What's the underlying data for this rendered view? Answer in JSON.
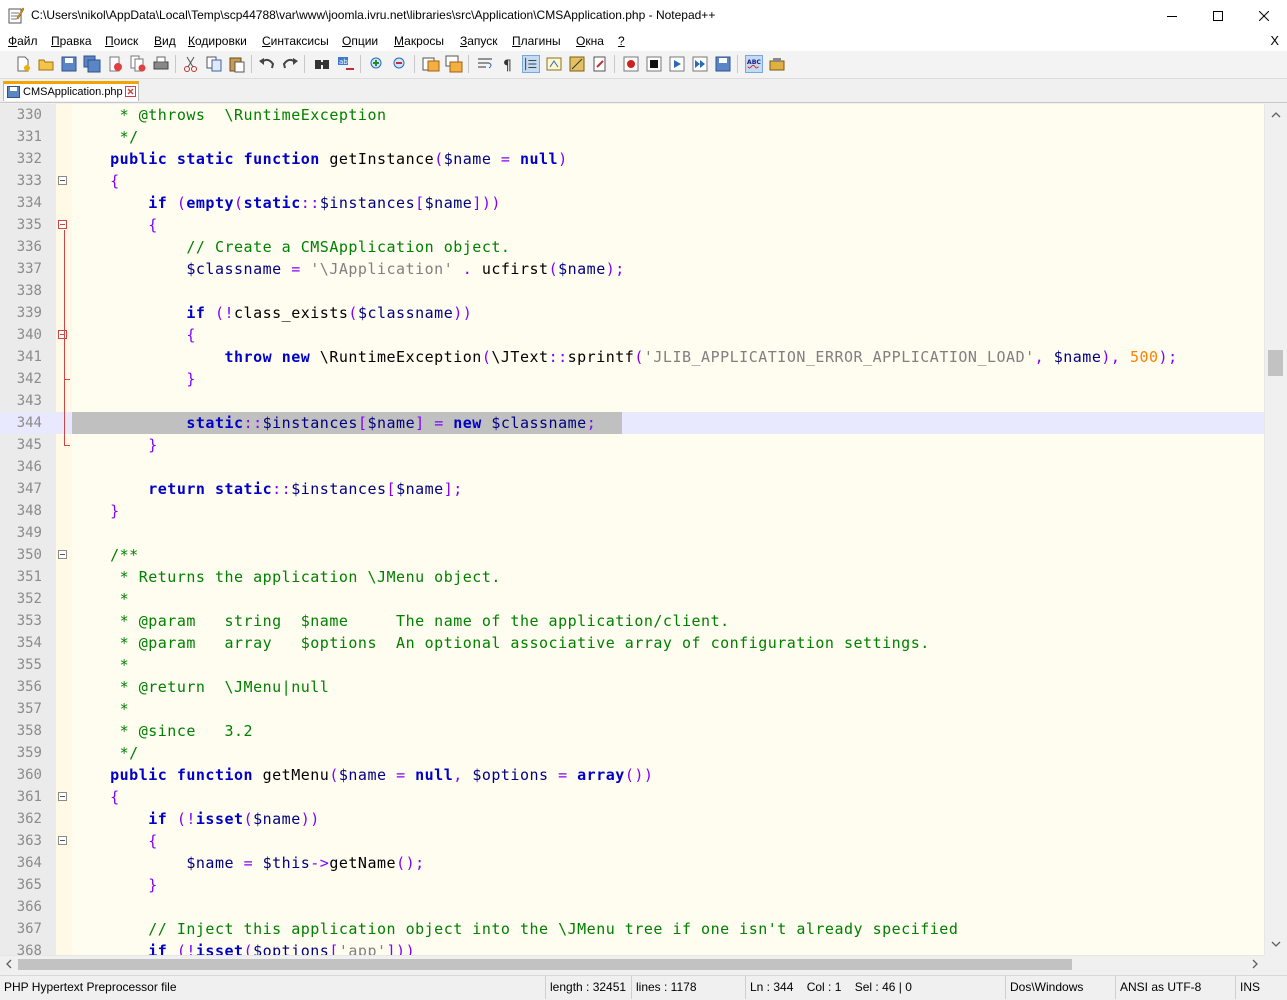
{
  "window": {
    "title": "C:\\Users\\nikol\\AppData\\Local\\Temp\\scp44788\\var\\www\\joomla.ivru.net\\libraries\\src\\Application\\CMSApplication.php - Notepad++"
  },
  "menu": {
    "items": [
      {
        "label": "Файл",
        "underline": "Ф",
        "rest": "айл"
      },
      {
        "label": "Правка",
        "underline": "П",
        "rest": "равка"
      },
      {
        "label": "Поиск",
        "underline": "П",
        "rest": "оиск"
      },
      {
        "label": "Вид",
        "underline": "В",
        "rest": "ид"
      },
      {
        "label": "Кодировки",
        "underline": "К",
        "rest": "одировки"
      },
      {
        "label": "Синтаксисы",
        "underline": "С",
        "rest": "интаксисы"
      },
      {
        "label": "Опции",
        "underline": "О",
        "rest": "пции"
      },
      {
        "label": "Макросы",
        "underline": "М",
        "rest": "акросы"
      },
      {
        "label": "Запуск",
        "underline": "З",
        "rest": "апуск"
      },
      {
        "label": "Плагины",
        "underline": "П",
        "rest": "лагины"
      },
      {
        "label": "Окна",
        "underline": "О",
        "rest": "кна"
      },
      {
        "label": "?",
        "underline": "?",
        "rest": ""
      }
    ],
    "close_label": "X"
  },
  "toolbar": {
    "icons": [
      "new-file-icon",
      "open-file-icon",
      "save-icon",
      "save-all-icon",
      "close-icon",
      "close-all-icon",
      "print-icon",
      "cut-icon",
      "copy-icon",
      "paste-icon",
      "undo-icon",
      "redo-icon",
      "find-icon",
      "replace-icon",
      "zoom-in-icon",
      "zoom-out-icon",
      "sync-vertical-icon",
      "sync-horizontal-icon",
      "word-wrap-icon",
      "show-all-chars-icon",
      "indent-guide-icon",
      "function-list-icon",
      "folder-workspace-icon",
      "document-map-icon",
      "record-macro-icon",
      "stop-record-icon",
      "play-macro-icon",
      "run-macro-multiple-icon",
      "save-macro-icon",
      "spell-check-icon",
      "plugin-icon"
    ]
  },
  "tab": {
    "label": "CMSApplication.php"
  },
  "editor": {
    "lines": [
      {
        "n": "330",
        "html": "     <span class=\"cm\">* @throws  \\RuntimeException</span>"
      },
      {
        "n": "331",
        "html": "     <span class=\"cm\">*/</span>"
      },
      {
        "n": "332",
        "html": "    <span class=\"kw\">public</span> <span class=\"kw\">static</span> <span class=\"kw\">function</span> getInstance<span class=\"br\">(</span><span class=\"var\">$name</span> <span class=\"op\">=</span> <span class=\"kw\">null</span><span class=\"br\">)</span>"
      },
      {
        "n": "333",
        "html": "    <span class=\"br\">{</span>",
        "fold": "open"
      },
      {
        "n": "334",
        "html": "        <span class=\"kw\">if</span> <span class=\"br\">(</span><span class=\"kw\">empty</span><span class=\"br\">(</span><span class=\"kw\">static</span><span class=\"op\">::</span><span class=\"var\">$instances</span><span class=\"br\">[</span><span class=\"var\">$name</span><span class=\"br\">]))</span>"
      },
      {
        "n": "335",
        "html": "        <span class=\"br\">{</span>",
        "fold": "red"
      },
      {
        "n": "336",
        "html": "            <span class=\"cm\">// Create a CMSApplication object.</span>"
      },
      {
        "n": "337",
        "html": "            <span class=\"var\">$classname</span> <span class=\"op\">=</span> <span class=\"str\">'\\JApplication'</span> <span class=\"op\">.</span> ucfirst<span class=\"br\">(</span><span class=\"var\">$name</span><span class=\"br\">)</span><span class=\"op\">;</span>"
      },
      {
        "n": "338",
        "html": ""
      },
      {
        "n": "339",
        "html": "            <span class=\"kw\">if</span> <span class=\"br\">(</span><span class=\"op\">!</span>class_exists<span class=\"br\">(</span><span class=\"var\">$classname</span><span class=\"br\">))</span>"
      },
      {
        "n": "340",
        "html": "            <span class=\"br\">{</span>",
        "fold": "red"
      },
      {
        "n": "341",
        "html": "                <span class=\"kw\">throw</span> <span class=\"kw\">new</span> \\RuntimeException<span class=\"br\">(</span>\\JText<span class=\"op\">::</span>sprintf<span class=\"br\">(</span><span class=\"str\">'JLIB_APPLICATION_ERROR_APPLICATION_LOAD'</span><span class=\"op\">,</span> <span class=\"var\">$name</span><span class=\"br\">)</span><span class=\"op\">,</span> <span class=\"num\">500</span><span class=\"br\">)</span><span class=\"op\">;</span>"
      },
      {
        "n": "342",
        "html": "            <span class=\"br\">}</span>"
      },
      {
        "n": "343",
        "html": ""
      },
      {
        "n": "344",
        "html": "            <span class=\"kw\">static</span><span class=\"op\">::</span><span class=\"var\">$instances</span><span class=\"br\">[</span><span class=\"var\">$name</span><span class=\"br\">]</span> <span class=\"op\">=</span> <span class=\"kw\">new</span> <span class=\"var\">$classname</span><span class=\"op\">;</span>",
        "current": true
      },
      {
        "n": "345",
        "html": "        <span class=\"br\">}</span>"
      },
      {
        "n": "346",
        "html": ""
      },
      {
        "n": "347",
        "html": "        <span class=\"kw\">return</span> <span class=\"kw\">static</span><span class=\"op\">::</span><span class=\"var\">$instances</span><span class=\"br\">[</span><span class=\"var\">$name</span><span class=\"br\">]</span><span class=\"op\">;</span>"
      },
      {
        "n": "348",
        "html": "    <span class=\"br\">}</span>"
      },
      {
        "n": "349",
        "html": ""
      },
      {
        "n": "350",
        "html": "    <span class=\"cm\">/**</span>",
        "fold": "open"
      },
      {
        "n": "351",
        "html": "     <span class=\"cm\">* Returns the application \\JMenu object.</span>"
      },
      {
        "n": "352",
        "html": "     <span class=\"cm\">*</span>"
      },
      {
        "n": "353",
        "html": "     <span class=\"cm\">* @param   string  $name     The name of the application/client.</span>"
      },
      {
        "n": "354",
        "html": "     <span class=\"cm\">* @param   array   $options  An optional associative array of configuration settings.</span>"
      },
      {
        "n": "355",
        "html": "     <span class=\"cm\">*</span>"
      },
      {
        "n": "356",
        "html": "     <span class=\"cm\">* @return  \\JMenu|null</span>"
      },
      {
        "n": "357",
        "html": "     <span class=\"cm\">*</span>"
      },
      {
        "n": "358",
        "html": "     <span class=\"cm\">* @since   3.2</span>"
      },
      {
        "n": "359",
        "html": "     <span class=\"cm\">*/</span>"
      },
      {
        "n": "360",
        "html": "    <span class=\"kw\">public</span> <span class=\"kw\">function</span> getMenu<span class=\"br\">(</span><span class=\"var\">$name</span> <span class=\"op\">=</span> <span class=\"kw\">null</span><span class=\"op\">,</span> <span class=\"var\">$options</span> <span class=\"op\">=</span> <span class=\"kw\">array</span><span class=\"br\">())</span>"
      },
      {
        "n": "361",
        "html": "    <span class=\"br\">{</span>",
        "fold": "open"
      },
      {
        "n": "362",
        "html": "        <span class=\"kw\">if</span> <span class=\"br\">(</span><span class=\"op\">!</span><span class=\"kw\">isset</span><span class=\"br\">(</span><span class=\"var\">$name</span><span class=\"br\">))</span>"
      },
      {
        "n": "363",
        "html": "        <span class=\"br\">{</span>",
        "fold": "open"
      },
      {
        "n": "364",
        "html": "            <span class=\"var\">$name</span> <span class=\"op\">=</span> <span class=\"var\">$this</span><span class=\"op\">-&gt;</span>getName<span class=\"br\">()</span><span class=\"op\">;</span>"
      },
      {
        "n": "365",
        "html": "        <span class=\"br\">}</span>"
      },
      {
        "n": "366",
        "html": ""
      },
      {
        "n": "367",
        "html": "        <span class=\"cm\">// Inject this application object into the \\JMenu tree if one isn't already specified</span>"
      },
      {
        "n": "368",
        "html": "        <span class=\"kw\">if</span> <span class=\"br\">(</span><span class=\"op\">!</span><span class=\"kw\">isset</span><span class=\"br\">(</span><span class=\"var\">$options</span><span class=\"br\">[</span><span class=\"str\">'app'</span><span class=\"br\">]))</span>"
      }
    ]
  },
  "status": {
    "filetype": "PHP Hypertext Preprocessor file",
    "length": "length : 32451",
    "lines": "lines : 1178",
    "position": "Ln : 344    Col : 1    Sel : 46 | 0",
    "eol": "Dos\\Windows",
    "encoding": "ANSI as UTF-8",
    "mode": "INS"
  },
  "colors": {
    "keyword": "#0000c8",
    "comment": "#008000",
    "string": "#808080",
    "number": "#ff8000",
    "operator": "#8000ff",
    "editor_bg": "#fffcf0",
    "current_line": "#e8e8ff",
    "tab_accent": "#f2a400"
  }
}
